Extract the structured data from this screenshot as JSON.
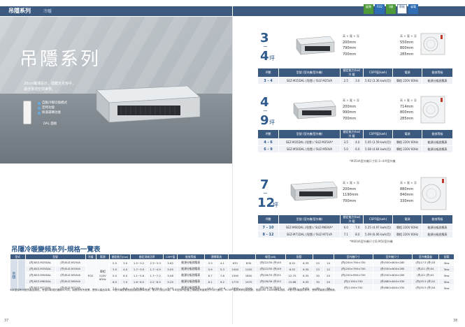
{
  "header": {
    "title": "吊隱系列",
    "subtitle": "冷暖",
    "badges": [
      "變頻",
      "R32",
      "1級",
      "節能",
      "省電"
    ]
  },
  "hero": {
    "title": "吊隱系列",
    "sub_line1": "20cm纖薄設計，隱藏天花板中，",
    "sub_line2": "最佳選項空間美學。",
    "features": [
      "自動冷暖切換模式",
      "定時功能",
      "除濕運轉功能"
    ],
    "dal_label": "DAL 面板"
  },
  "sections": [
    {
      "num": "3",
      "tilde": "~",
      "num2": "4",
      "ping": "坪",
      "indoor_dims_header": "高 × 寬 × 深",
      "indoor_dims": [
        "200mm",
        "790mm",
        "700mm"
      ],
      "outdoor_dims_header": "高 × 寬 × 深",
      "outdoor_dims": [
        "550mm",
        "800mm",
        "285mm"
      ],
      "table": {
        "headers": [
          "坪數",
          "型號 (室內機/室外機)",
          "額定能力(kw) 冷 暖",
          "CSPF值(kwh)",
          "電源",
          "能效等級"
        ],
        "rows": [
          [
            "3 - 4",
            "SEZ-M25DAL (吊隱) / SUZ-M25VA",
            "2.5",
            "3.0",
            "5.62 (3.36 kwh/月)",
            "單相 220V 60Hz",
            "能源分級對應表"
          ]
        ]
      }
    },
    {
      "num": "4",
      "tilde": "~",
      "num2": "9",
      "ping": "坪",
      "indoor_dims_header": "高 × 寬 × 深",
      "indoor_dims": [
        "200mm",
        "990mm",
        "700mm"
      ],
      "outdoor_dims_header": "高 × 寬 × 深",
      "outdoor_dims": [
        "714mm",
        "800mm",
        "285mm"
      ],
      "table": {
        "headers": [
          "坪數",
          "型號 (室內機/室外機)",
          "額定能力(kw) 冷 暖",
          "CSPF值(kwh)",
          "電源",
          "能效等級"
        ],
        "rows": [
          [
            "4 - 6",
            "SEZ-M35DAL (吊隱) / SUZ-M35VA*",
            "3.5",
            "4.0",
            "5.05 (3.59 kwh/月)",
            "單相 220V 60Hz",
            "能源分級對應表"
          ],
          [
            "6 - 9",
            "SEZ-M50DAL (吊隱) / SUZ-M50VA",
            "5.0",
            "6.0",
            "5.08 (4.64 kwh/月)",
            "單相 220V 60Hz",
            "能源分級對應表"
          ]
        ]
      },
      "note": "*M35VA室外機尺寸同 3~4坪室外機"
    },
    {
      "num": "7",
      "tilde": "~",
      "num2": "12",
      "ping": "坪",
      "indoor_dims_header": "高 × 寬 × 深",
      "indoor_dims": [
        "200mm",
        "1190mm",
        "700mm"
      ],
      "outdoor_dims_header": "高 × 寬 × 深",
      "outdoor_dims": [
        "880mm",
        "840mm",
        "330mm"
      ],
      "table": {
        "headers": [
          "坪數",
          "型號 (室內機/室外機)",
          "額定能力(kw) 冷 暖",
          "CSPF值(kwh)",
          "電源",
          "能效等級"
        ],
        "rows": [
          [
            "7 - 10",
            "SEZ-M60DAL (吊隱) / SUZ-M60VA*",
            "6.0",
            "7.0",
            "5.25 (4.97 kwh/月)",
            "單相 220V 60Hz",
            "能源分級對應表"
          ],
          [
            "8 - 12",
            "SEZ-M71DAL (吊隱) / SUZ-M71VA",
            "7.1",
            "8.0",
            "5.09 (6.06 kwh/月)",
            "單相 220V 60Hz",
            "能源分級對應表"
          ]
        ]
      },
      "note": "*M60VA室外機尺寸同 M50室外機"
    }
  ],
  "bottom": {
    "title": "吊隱冷暖變頻系列-規格一覽表",
    "headers": [
      "型式",
      "",
      "型號",
      "",
      "冷媒",
      "電源",
      "額定能力(kw)",
      "",
      "額定消耗功率",
      "運轉電流",
      "CSPF值",
      "",
      "能效等級",
      "噪音(dB)",
      "",
      "配管",
      "",
      "室內機尺寸",
      "室外機尺寸",
      "室外機重量",
      "配電"
    ],
    "rows": [
      [
        "(內)SEZ-M25DAL",
        "(外)SUZ-M25VA",
        "2.5",
        "3.0",
        "1.5~3.2",
        "2.3~3.3",
        "5.62",
        "能源分級對應表",
        "3.3",
        "4.1",
        "670",
        "830",
        "(內)22/30 (外)45",
        "6.52",
        "6.35",
        "23",
        "10",
        "(內)200×790×700",
        "(外)550×800×285",
        "(內)17.5 (外)33",
        "3kw"
      ],
      [
        "(內)SEZ-M35DAL",
        "(外)SUZ-M35VA",
        "3.5",
        "4.0",
        "1.7~3.9",
        "1.7~4.9",
        "5.05",
        "能源分級對應表",
        "5.9",
        "5.3",
        "1040",
        "1100",
        "(內)22/30 (外)49",
        "6.52",
        "6.35",
        "23",
        "12",
        "(內)200×790×700",
        "(外)550×800×285",
        "(內)21 (外)34",
        "3kw"
      ],
      [
        "(內)SEZ-M50DAL",
        "(外)SUZ-M50VA",
        "5.0",
        "6.0",
        "1.1~5.6",
        "1.7~7.2",
        "5.08",
        "能源分級對應表",
        "6.7",
        "7.8",
        "1590",
        "1850",
        "(內)28/33 (外)51",
        "12.70",
        "6.35",
        "30",
        "20",
        "(內)200×990×700",
        "(外)550×800×285",
        "(內)22 (外)41",
        "5kw"
      ],
      [
        "(內)SEZ-M60DAL",
        "(外)SUZ-M60VA",
        "6.0",
        "7.0",
        "1.6~6.5",
        "2.2~8.5",
        "5.25",
        "能源分級對應表",
        "8.1",
        "9.2",
        "1770",
        "1970",
        "(內)28/36 (外)52",
        "15.88",
        "6.35",
        "30",
        "20",
        "(內)1190×700",
        "(外)880×840×330",
        "(內)35.5 (外)41",
        "5kw"
      ],
      [
        "(內)SEZ-M71DAL",
        "(外)SUZ-M71VA",
        "7.1",
        "8.0",
        "2.3~8.2",
        "2.6~10.4",
        "5.09",
        "能源分級對應表",
        "10.7",
        "10.6",
        "1950",
        "2200",
        "(內)28/36 (外)55",
        "15.88",
        "6.52",
        "30",
        "30",
        "(內)1190×700",
        "(外)880×840×330",
        "(內)35.5 (外)54",
        "5kw"
      ]
    ],
    "side_label": "吊隱",
    "refrigerant": "R32",
    "power": "單相220V 60Hz",
    "footnote": "※本型錄所刊登的產品顏色，會因印刷或拍攝條件不同，與實物有所差異，實際以產品為準。※室外機配管長度如超過標準長度，需另行追加冷媒。※本型錄所記載之規格如有變更恕不另行通知。※CSPF值為季節性能因數，依據CNS 14464標準測試。※室內外機僅供參考，實際安裝請洽經銷商。"
  },
  "pages": [
    "37",
    "38"
  ]
}
